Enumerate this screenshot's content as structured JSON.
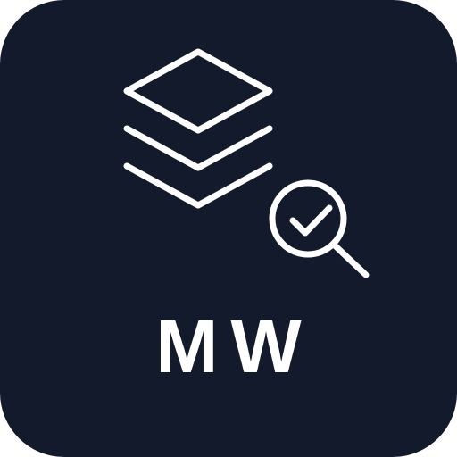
{
  "app_icon": {
    "label": "MW",
    "background_color": "#131a2b",
    "foreground_color": "#ffffff",
    "icons": {
      "layers": "layers-stack-icon",
      "search": "magnifier-check-icon"
    }
  }
}
